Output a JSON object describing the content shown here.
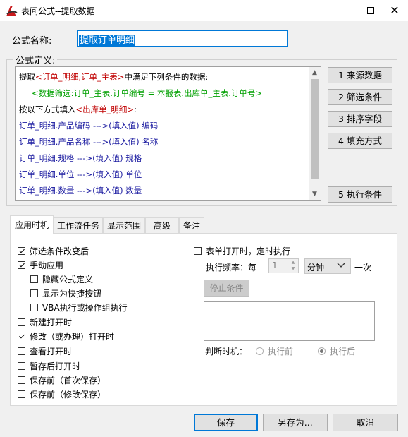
{
  "window": {
    "title": "表间公式--提取数据",
    "maximize_icon": "maximize-icon",
    "close_icon": "close-icon",
    "close_glyph": "✕"
  },
  "name": {
    "label": "公式名称:",
    "value": "提取订单明细"
  },
  "definition": {
    "legend": "公式定义:",
    "lines": [
      {
        "parts": [
          {
            "t": "提取",
            "c": "black"
          },
          {
            "t": "<订单_明细,订单_主表>",
            "c": "red"
          },
          {
            "t": "中满足下列条件的数据:",
            "c": "black"
          }
        ]
      },
      {
        "parts": [
          {
            "t": "<数据筛选:订单_主表.订单编号 = 本报表.出库单_主表.订单号>",
            "c": "green"
          }
        ]
      },
      {
        "parts": [
          {
            "t": "按以下方式填入",
            "c": "black"
          },
          {
            "t": "<出库单_明细>",
            "c": "red"
          },
          {
            "t": ":",
            "c": "black"
          }
        ]
      },
      {
        "parts": [
          {
            "t": "订单_明细.产品编码  --->(填入值)  编码",
            "c": "blue"
          }
        ]
      },
      {
        "parts": [
          {
            "t": "订单_明细.产品名称  --->(填入值)  名称",
            "c": "blue"
          }
        ]
      },
      {
        "parts": [
          {
            "t": "订单_明细.规格  --->(填入值)  规格",
            "c": "blue"
          }
        ]
      },
      {
        "parts": [
          {
            "t": "订单_明细.单位  --->(填入值)  单位",
            "c": "blue"
          }
        ]
      },
      {
        "parts": [
          {
            "t": "订单_明细.数量  --->(填入值)  数量",
            "c": "blue"
          }
        ]
      }
    ]
  },
  "side_buttons": [
    "1  来源数据",
    "2  筛选条件",
    "3  排序字段",
    "4 填充方式",
    "5 执行条件"
  ],
  "tabs": [
    "应用时机",
    "工作流任务",
    "显示范围",
    "高级",
    "备注"
  ],
  "left_options": [
    {
      "label": "筛选条件改变后",
      "checked": true
    },
    {
      "label": "手动应用",
      "checked": true
    },
    {
      "label": "隐藏公式定义",
      "checked": false
    },
    {
      "label": "显示为快捷按钮",
      "checked": false
    },
    {
      "label": "VBA执行或操作组执行",
      "checked": false
    },
    {
      "label": "新建打开时",
      "checked": false
    },
    {
      "label": "修改（或办理）打开时",
      "checked": true
    },
    {
      "label": "查看打开时",
      "checked": false
    },
    {
      "label": "暂存后打开时",
      "checked": false
    },
    {
      "label": "保存前（首次保存）",
      "checked": false
    },
    {
      "label": "保存前（修改保存）",
      "checked": false
    }
  ],
  "timer": {
    "label": "表单打开时，定时执行",
    "checked": false,
    "freq_label": "执行频率：每",
    "freq_value": "1",
    "unit": "分钟",
    "suffix": "一次",
    "stop_button": "停止条件",
    "judge_label": "判断时机：",
    "radio_before": "执行前",
    "radio_after": "执行后",
    "selected": "after"
  },
  "buttons": {
    "save": "保存",
    "save_as": "另存为...",
    "cancel": "取消"
  },
  "colors": {
    "accent": "#0078d7",
    "red": "#c00000",
    "green": "#00a000",
    "blue": "#1a1aa0"
  }
}
